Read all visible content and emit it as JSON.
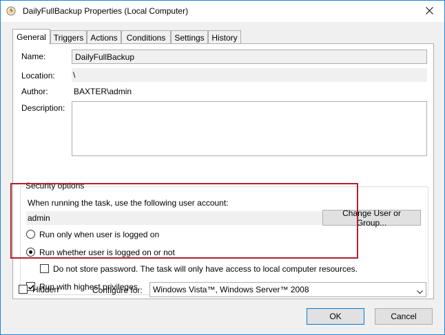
{
  "window": {
    "title": "DailyFullBackup Properties (Local Computer)"
  },
  "tabs": [
    {
      "label": "General",
      "active": true
    },
    {
      "label": "Triggers",
      "active": false
    },
    {
      "label": "Actions",
      "active": false
    },
    {
      "label": "Conditions",
      "active": false
    },
    {
      "label": "Settings",
      "active": false
    },
    {
      "label": "History",
      "active": false
    }
  ],
  "general": {
    "name_label": "Name:",
    "name_value": "DailyFullBackup",
    "location_label": "Location:",
    "location_value": "\\",
    "author_label": "Author:",
    "author_value": "BAXTER\\admin",
    "description_label": "Description:",
    "description_value": ""
  },
  "security": {
    "group_title": "Security options",
    "account_prompt": "When running the task, use the following user account:",
    "account_value": "admin",
    "change_button": "Change User or Group...",
    "run_logged_on": {
      "label": "Run only when user is logged on",
      "selected": false
    },
    "run_whether": {
      "label": "Run whether user is logged on or not",
      "selected": true
    },
    "no_store_password": {
      "label": "Do not store password.  The task will only have access to local computer resources.",
      "checked": false
    },
    "highest_privileges": {
      "label": "Run with highest privileges",
      "checked": true
    }
  },
  "bottom": {
    "hidden": {
      "label": "Hidden",
      "checked": false
    },
    "configure_label": "Configure for:",
    "configure_value": "Windows Vista™, Windows Server™ 2008"
  },
  "footer": {
    "ok_label": "OK",
    "cancel_label": "Cancel"
  },
  "colors": {
    "accent": "#0078d7",
    "highlight_box": "#b01e30"
  }
}
